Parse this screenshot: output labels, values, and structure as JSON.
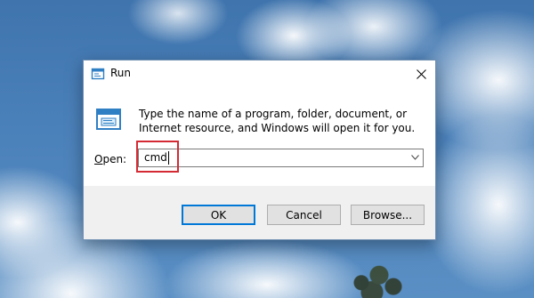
{
  "window": {
    "title": "Run",
    "icon": "run-icon",
    "close_icon": "close-icon"
  },
  "content": {
    "icon": "run-icon",
    "instruction": "Type the name of a program, folder, document, or Internet resource, and Windows will open it for you."
  },
  "open_field": {
    "label_prefix": "",
    "label_access_key": "O",
    "label_rest": "pen:",
    "value": "cmd"
  },
  "buttons": {
    "ok": "OK",
    "cancel": "Cancel",
    "browse": "Browse..."
  },
  "colors": {
    "highlight": "#d42a34",
    "accent": "#0078d7",
    "dialog_background": "#f0f0f0"
  }
}
